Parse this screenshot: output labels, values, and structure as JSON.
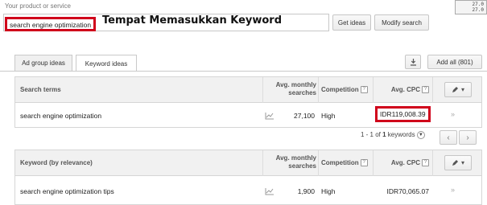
{
  "top_label": "Your product or service",
  "corner_badge": [
    "27.0",
    "27.0"
  ],
  "search": {
    "value": "search engine optimization"
  },
  "annotation": "Tempat Memasukkan Keyword",
  "buttons": {
    "get_ideas": "Get ideas",
    "modify_search": "Modify search",
    "add_all": "Add all (801)"
  },
  "tabs": [
    {
      "label": "Ad group ideas"
    },
    {
      "label": "Keyword ideas"
    }
  ],
  "table_top": {
    "headers": {
      "term": "Search terms",
      "searches": "Avg. monthly searches",
      "competition": "Competition",
      "cpc": "Avg. CPC"
    },
    "rows": [
      {
        "keyword": "search engine optimization",
        "searches": "27,100",
        "competition": "High",
        "cpc": "IDR119,008.39"
      }
    ]
  },
  "pager": {
    "text_prefix": "1 - 1 of ",
    "count": "1",
    "text_suffix": " keywords"
  },
  "table_bottom": {
    "headers": {
      "term": "Keyword (by relevance)",
      "searches": "Avg. monthly searches",
      "competition": "Competition",
      "cpc": "Avg. CPC"
    },
    "rows": [
      {
        "keyword": "search engine optimization tips",
        "searches": "1,900",
        "competition": "High",
        "cpc": "IDR70,065.07"
      }
    ]
  },
  "colors": {
    "highlight": "#d0021b",
    "header_bg": "#f1f1f1"
  }
}
